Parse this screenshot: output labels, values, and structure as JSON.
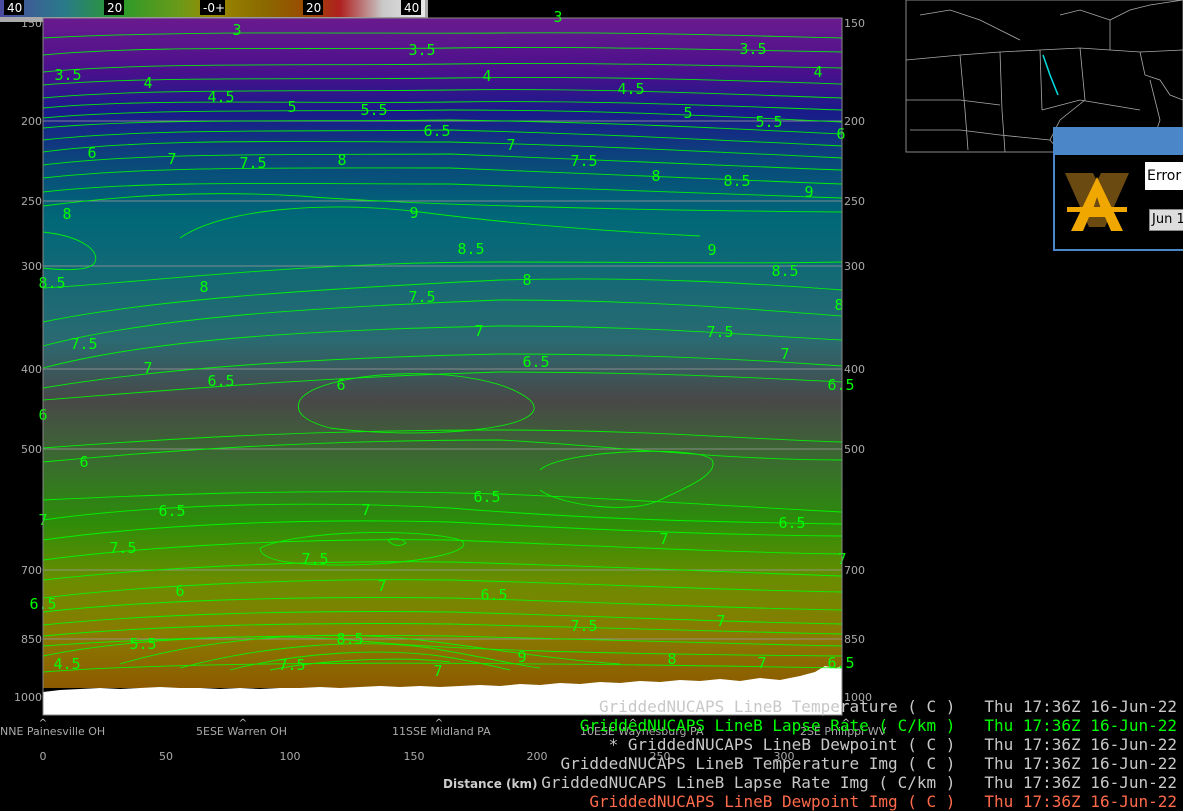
{
  "colorbar": {
    "labels": [
      "40",
      "20",
      "-0+",
      "20",
      "40"
    ]
  },
  "pressure_axis": {
    "left_labels": [
      "150",
      "200",
      "250",
      "300",
      "400",
      "500",
      "700",
      "850",
      "1000"
    ],
    "right_labels": [
      "150",
      "200",
      "250",
      "300",
      "400",
      "500",
      "700",
      "850",
      "1000"
    ]
  },
  "distance_axis": {
    "title": "Distance (km)",
    "ticks": [
      "0",
      "50",
      "100",
      "150",
      "200",
      "250",
      "300"
    ]
  },
  "locations": [
    "NNE Painesville OH",
    "5ESE Warren OH",
    "11SSE Midland PA",
    "10ESE Waynesburg PA",
    "2SE Philippi WV"
  ],
  "contour_labels": [
    "3",
    "3",
    "3.5",
    "3.5",
    "3.5",
    "4",
    "4",
    "4",
    "4.5",
    "4.5",
    "5",
    "5",
    "5.5",
    "5.5",
    "6",
    "6",
    "6.5",
    "7",
    "7",
    "7.5",
    "7.5",
    "8",
    "8",
    "8.5",
    "9",
    "8",
    "9",
    "8.5",
    "9",
    "8.5",
    "8.5",
    "8",
    "8",
    "8",
    "7.5",
    "7.5",
    "7.5",
    "7",
    "7",
    "7",
    "6.5",
    "6.5",
    "6",
    "6",
    "6",
    "6.5",
    "7",
    "6.5",
    "7",
    "6.5",
    "7",
    "7.5",
    "7.5",
    "7",
    "6.5",
    "6",
    "7",
    "6.5",
    "5.5",
    "8.5",
    "7.5",
    "6.5",
    "7",
    "4.5",
    "7.5",
    "9",
    "8",
    "7",
    "7",
    "6.5"
  ],
  "legend": [
    {
      "name": "GriddedNUCAPS LineB Temperature ( C )",
      "time": "Thu 17:36Z 16-Jun-22",
      "color": "#c8c8c8"
    },
    {
      "name": "GriddedNUCAPS LineB Lapse Rate ( C/km )",
      "time": "Thu 17:36Z 16-Jun-22",
      "color": "#00ff00"
    },
    {
      "name": "* GriddedNUCAPS LineB Dewpoint ( C )",
      "time": "Thu 17:36Z 16-Jun-22",
      "color": "#c8c8c8"
    },
    {
      "name": "GriddedNUCAPS LineB Temperature Img ( C )",
      "time": "Thu 17:36Z 16-Jun-22",
      "color": "#c8c8c8"
    },
    {
      "name": "GriddedNUCAPS LineB Lapse Rate Img ( C/km )",
      "time": "Thu 17:36Z 16-Jun-22",
      "color": "#c8c8c8"
    },
    {
      "name": "GriddedNUCAPS LineB Dewpoint Img ( C )",
      "time": "Thu 17:36Z 16-Jun-22",
      "color": "#ff6a4a"
    }
  ],
  "dialog": {
    "message": "Error a",
    "button": "Jun 1"
  },
  "colors": {
    "contour": "#00ff00",
    "gridline": "#9a9a9a",
    "dialog_border": "#4a86c8"
  }
}
